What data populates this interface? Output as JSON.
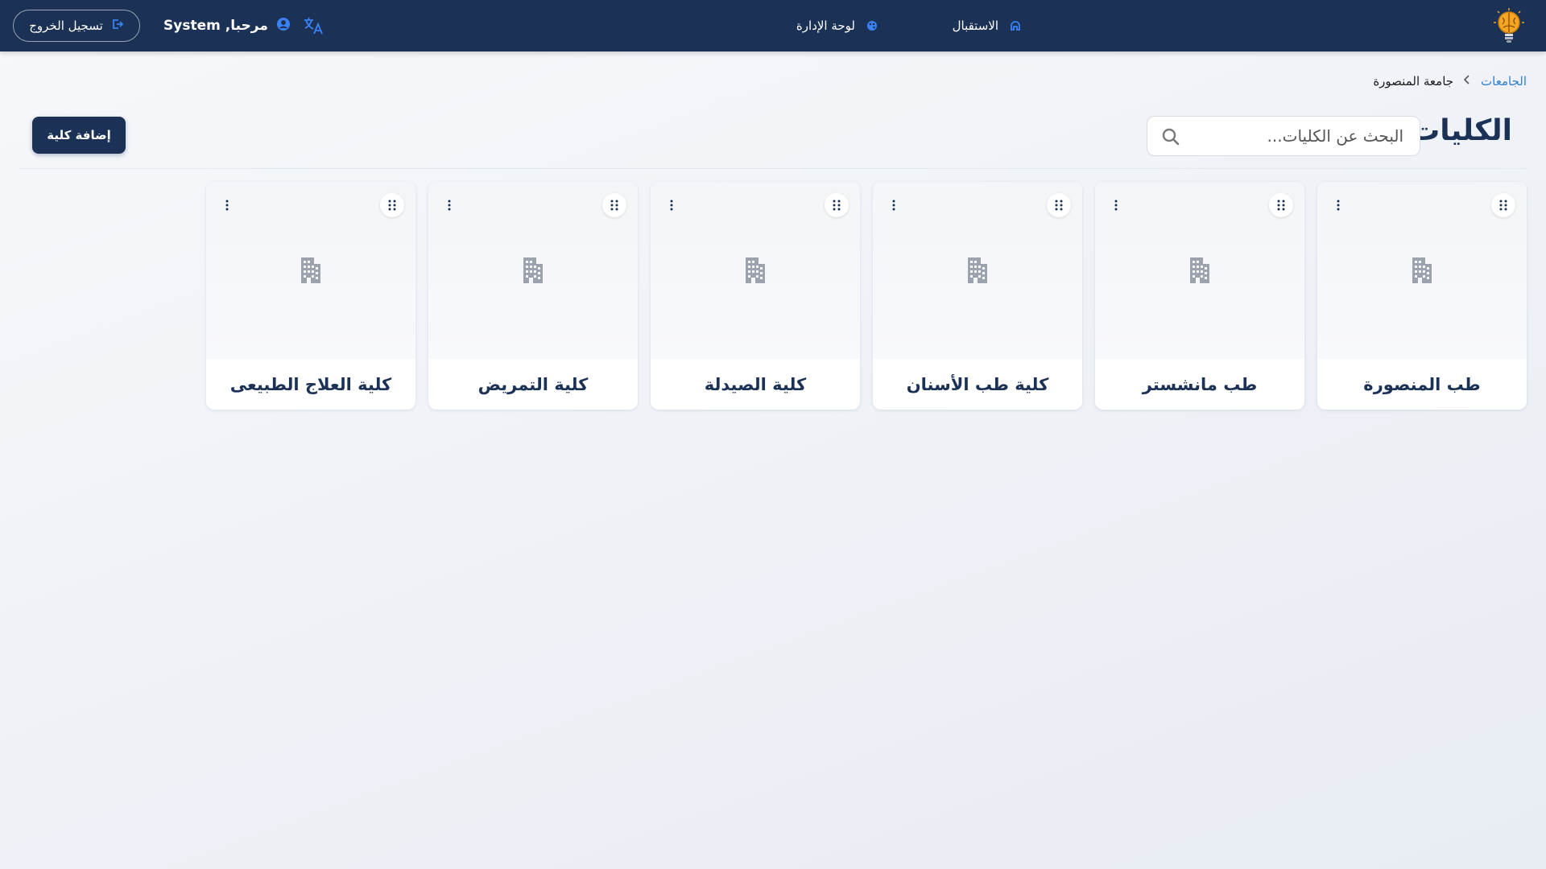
{
  "navbar": {
    "home_label": "الاستقبال",
    "dashboard_label": "لوحة الإدارة",
    "welcome_text": "مرحبا, System",
    "logout_label": "تسجيل الخروج"
  },
  "breadcrumb": {
    "parent": "الجامعات",
    "current": "جامعة المنصورة"
  },
  "page": {
    "title": "الكليات",
    "search_placeholder": "البحث عن الكليات...",
    "add_button": "إضافة كلية"
  },
  "colors": {
    "navbar_bg": "#1b3256",
    "primary": "#1b3256",
    "link": "#2f7fd0",
    "icon_accent": "#3b82f6",
    "building_icon": "#9ca3af"
  },
  "icons": {
    "logo": "brain-bulb-logo",
    "home": "home-icon",
    "dashboard": "palette-icon",
    "language": "translate-icon",
    "user": "user-circle-icon",
    "logout": "logout-icon",
    "search": "search-icon",
    "drag": "drag-handle-icon",
    "more": "more-vertical-icon",
    "card_placeholder": "building-icon"
  },
  "cards": [
    {
      "title": "طب المنصورة"
    },
    {
      "title": "طب مانشستر"
    },
    {
      "title": "كلية طب الأسنان"
    },
    {
      "title": "كلية الصيدلة"
    },
    {
      "title": "كلية التمريض"
    },
    {
      "title": "كلية العلاج الطبيعى"
    }
  ]
}
